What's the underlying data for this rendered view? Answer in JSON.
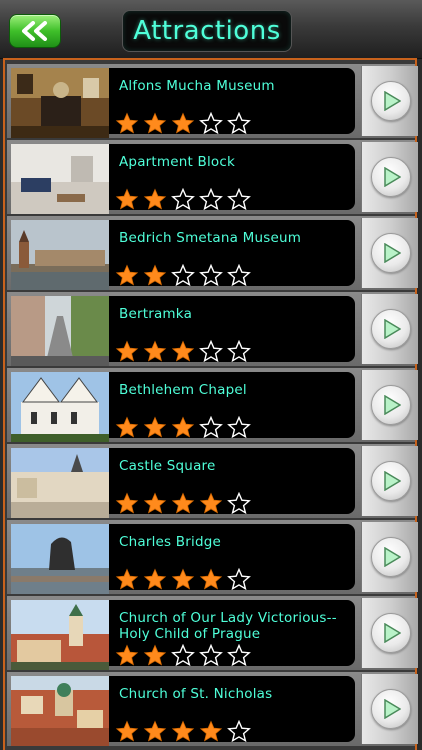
{
  "header": {
    "title": "Attractions",
    "back_icon": "double-chevron-left-icon",
    "accent_color": "#4fffd9"
  },
  "colors": {
    "star_filled": "#ff8a1c",
    "star_empty": "#ffffff",
    "list_border": "#c8621c",
    "back_button": "#3fbf2a"
  },
  "attractions": [
    {
      "name": "Alfons Mucha Museum",
      "rating": 3,
      "rating_max": 5
    },
    {
      "name": "Apartment Block",
      "rating": 2,
      "rating_max": 5
    },
    {
      "name": "Bedrich Smetana Museum",
      "rating": 2,
      "rating_max": 5
    },
    {
      "name": "Bertramka",
      "rating": 3,
      "rating_max": 5
    },
    {
      "name": "Bethlehem Chapel",
      "rating": 3,
      "rating_max": 5
    },
    {
      "name": "Castle Square",
      "rating": 4,
      "rating_max": 5
    },
    {
      "name": "Charles Bridge",
      "rating": 4,
      "rating_max": 5
    },
    {
      "name": "Church of Our Lady Victorious--Holy Child of Prague",
      "rating": 2,
      "rating_max": 5
    },
    {
      "name": "Church of St. Nicholas",
      "rating": 4,
      "rating_max": 5
    }
  ]
}
